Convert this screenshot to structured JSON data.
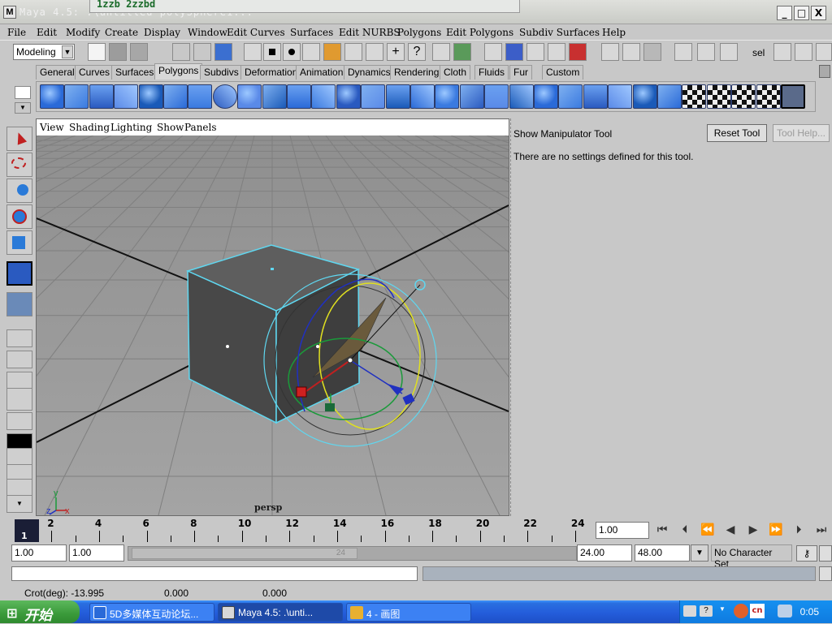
{
  "window": {
    "title": "Maya 4.5: .\\untitled        polySphere1...",
    "ime_text": "1zzb 2zzbd",
    "controls": [
      "_",
      "□",
      "X"
    ]
  },
  "menubar": [
    "File",
    "Edit",
    "Modify",
    "Create",
    "Display",
    "Window",
    "Edit Curves",
    "Surfaces",
    "Edit NURBS",
    "Polygons",
    "Edit Polygons",
    "Subdiv Surfaces",
    "Help"
  ],
  "statusline": {
    "menu_set": "Modeling",
    "sel_label": "sel"
  },
  "shelf": {
    "tabs": [
      "General",
      "Curves",
      "Surfaces",
      "Polygons",
      "Subdivs",
      "Deformation",
      "Animation",
      "Dynamics",
      "Rendering",
      "Cloth",
      "Fluids",
      "Fur",
      "Custom"
    ],
    "active_tab": "Polygons",
    "icons": [
      "poly-sphere",
      "poly-cube",
      "poly-cylinder",
      "poly-cone",
      "poly-plane",
      "poly-torus",
      "poly-pipe",
      "poly-helix",
      "poly-soccer",
      "poly-platonic",
      "append-polygon",
      "create-polygon",
      "split-polygon",
      "extrude-face",
      "extrude-edge",
      "bevel",
      "merge-vertices",
      "combine",
      "separate",
      "smooth",
      "triangulate",
      "quadrangulate",
      "reverse",
      "soften",
      "harden",
      "planar-mapping",
      "cylindrical-mapping",
      "spherical-mapping",
      "uv-texture-editor",
      "automatic-mapping",
      "selection-constraint"
    ]
  },
  "viewport": {
    "menu": [
      "View",
      "Shading",
      "Lighting",
      "Show",
      "Panels"
    ],
    "camera_label": "persp",
    "axis_labels": {
      "x": "x",
      "y": "y",
      "z": "z"
    }
  },
  "tool_settings": {
    "title": "Show Manipulator Tool",
    "message": "There are no settings defined for this tool.",
    "reset_button": "Reset Tool",
    "help_button": "Tool Help..."
  },
  "timeline": {
    "current_frame": "1",
    "ticks": [
      "2",
      "4",
      "6",
      "8",
      "10",
      "12",
      "14",
      "16",
      "18",
      "20",
      "22",
      "24"
    ],
    "current_time": "1.00"
  },
  "range": {
    "start_time": "1.00",
    "playback_start": "1.00",
    "playback_end": "24.00",
    "end_time": "48.00",
    "slider_end_label": "24",
    "character_set": "No Character Set"
  },
  "helpline": {
    "label": "Crot(deg): -13.995",
    "value2": "0.000",
    "value3": "0.000"
  },
  "taskbar": {
    "start_label": "开始",
    "tasks": [
      "5D多媒体互动论坛...",
      "Maya 4.5: .\\unti...",
      "4 - 画图"
    ],
    "clock": "0:05",
    "lang": "cn"
  },
  "colors": {
    "viewport_bg": "#9a9a9a",
    "selection_cyan": "#5fd7f0",
    "taskbar_blue": "#245ddb",
    "start_green": "#3a9a3a"
  }
}
